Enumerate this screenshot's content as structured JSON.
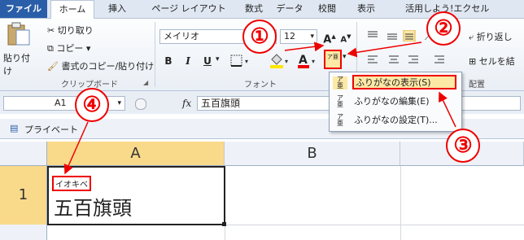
{
  "tabs": [
    "ファイル",
    "ホーム",
    "挿入",
    "ページ レイアウト",
    "数式",
    "データ",
    "校閲",
    "表示",
    "活用しよう!エクセル"
  ],
  "clipboard": {
    "paste_label": "貼り付け",
    "cut_label": "切り取り",
    "copy_label": "コピー ▾",
    "format_painter_label": "書式のコピー/貼り付け",
    "group_label": "クリップボード"
  },
  "font": {
    "name": "メイリオ",
    "size": "12",
    "grow": "A",
    "shrink": "A",
    "bold": "B",
    "italic": "I",
    "underline": "U",
    "group_label": "フォント",
    "underline_arrow": "▾",
    "font_color_letter": "A",
    "furigana_icon": "ア亜"
  },
  "alignment": {
    "wrap_label": "折り返し",
    "merge_label": "セルを結",
    "group_label": "配置"
  },
  "furigana_menu": {
    "items": [
      {
        "label": "ふりがなの表示(S)",
        "highlighted": true
      },
      {
        "label": "ふりがなの編集(E)",
        "highlighted": false
      },
      {
        "label": "ふりがなの設定(T)...",
        "highlighted": false
      }
    ]
  },
  "formula_bar": {
    "name_box": "A1",
    "fx": "fx",
    "content": "五百旗頭"
  },
  "workbook": {
    "title": "プライベート"
  },
  "sheet": {
    "columns": [
      "A",
      "B"
    ],
    "rows": [
      "1"
    ],
    "cell_a1_furigana": "イオキベ",
    "cell_a1_value": "五百旗頭"
  },
  "annotations": {
    "markers": [
      "①",
      "②",
      "③",
      "④"
    ],
    "color": "#e00000"
  }
}
